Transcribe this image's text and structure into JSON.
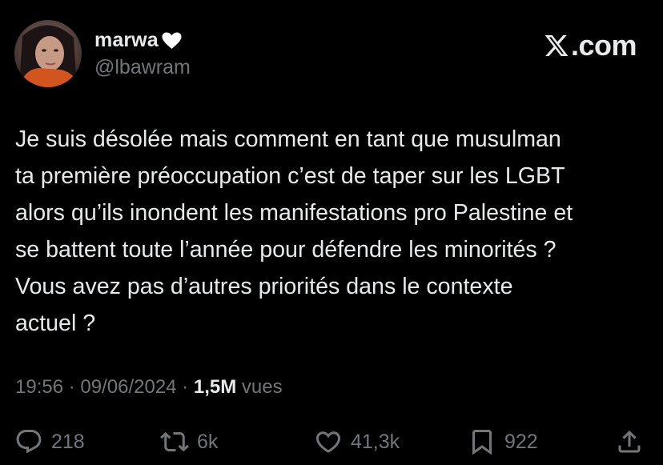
{
  "author": {
    "display_name": "marwa",
    "handle": "@lbawram"
  },
  "brand": {
    "label": ".com"
  },
  "tweet": {
    "lines": [
      "Je suis désolée mais comment en tant que musulman",
      "ta première préoccupation c’est de taper sur les LGBT",
      "alors qu’ils inondent les manifestations pro Palestine et",
      "se battent toute l’année pour défendre les minorités ?",
      "Vous avez pas d’autres priorités dans le contexte",
      "actuel ?"
    ]
  },
  "meta": {
    "time": "19:56",
    "separator": "·",
    "date": "09/06/2024",
    "views_count": "1,5M",
    "views_label": "vues"
  },
  "actions": {
    "replies": "218",
    "reposts": "6k",
    "likes": "41,3k",
    "bookmarks": "922"
  },
  "icons": [
    "heart-emoji-icon",
    "x-logo-icon",
    "reply-icon",
    "repost-icon",
    "like-icon",
    "bookmark-icon",
    "share-icon"
  ],
  "colors": {
    "background": "#000000",
    "text": "#e7e9ea",
    "secondary": "#71767b"
  }
}
